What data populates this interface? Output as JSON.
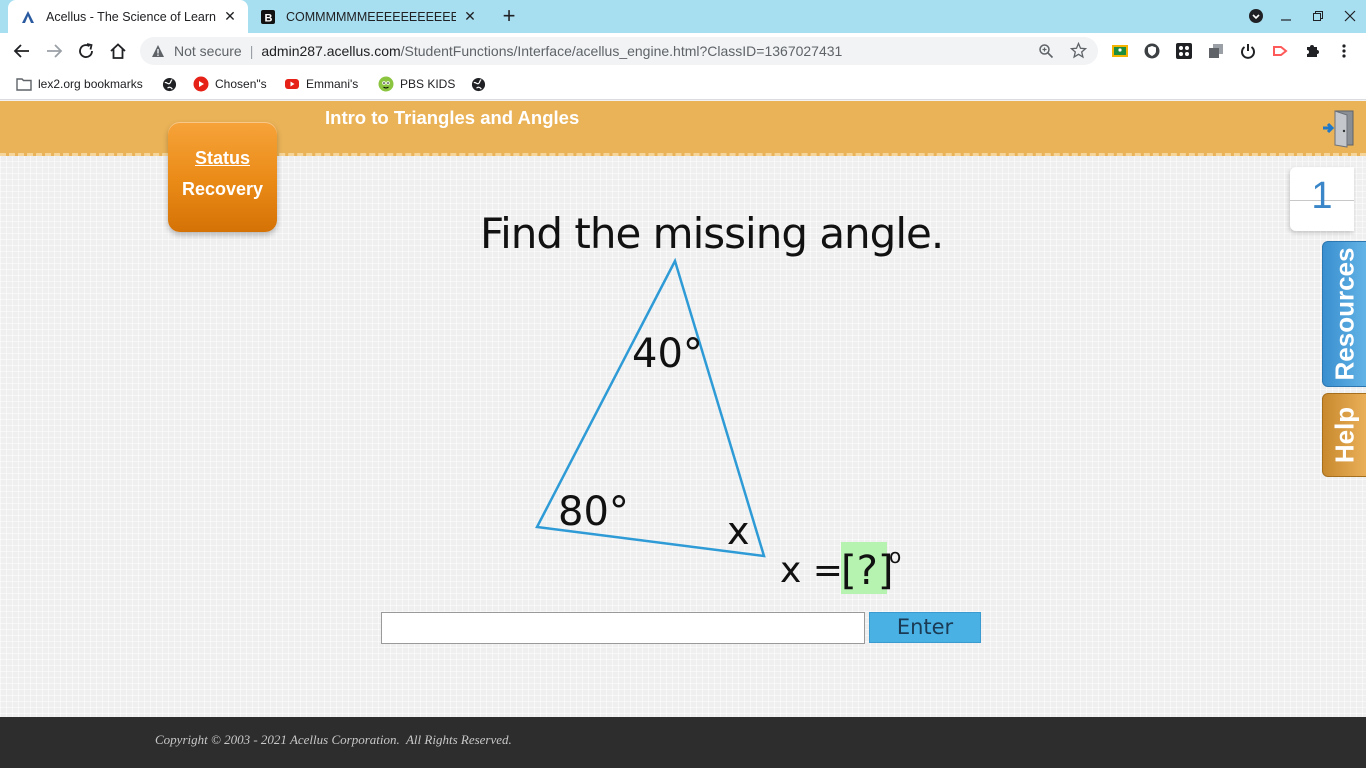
{
  "browser": {
    "tabs": [
      {
        "title": "Acellus - The Science of Learning",
        "active": true
      },
      {
        "title": "COMMMMMMEEEEEEEEEEEEEEE",
        "active": false
      }
    ],
    "omnibox": {
      "security_label": "Not secure",
      "host": "admin287.acellus.com",
      "path": "/StudentFunctions/Interface/acellus_engine.html?ClassID=1367027431"
    },
    "bookmarks": [
      {
        "label": "lex2.org bookmarks",
        "icon": "folder-icon"
      },
      {
        "label": "",
        "icon": "globe-icon"
      },
      {
        "label": "Chosen\"s",
        "icon": "youtube-icon"
      },
      {
        "label": "Emmani's",
        "icon": "youtube-icon"
      },
      {
        "label": "PBS KIDS",
        "icon": "pbs-kids-icon"
      },
      {
        "label": "",
        "icon": "globe-icon"
      }
    ]
  },
  "lesson": {
    "title": "Intro to Triangles and Angles",
    "status_button": {
      "line1": "Status",
      "line2": "Recovery"
    },
    "counter": "1",
    "side_tabs": {
      "resources": "Resources",
      "help": "Help"
    }
  },
  "problem": {
    "question": "Find the missing angle.",
    "angle_top": "40°",
    "angle_left": "80°",
    "angle_right": "x",
    "equation_lhs": "x =",
    "equation_blank": "[?]",
    "equation_unit": "o"
  },
  "answer": {
    "value": "",
    "enter_label": "Enter"
  },
  "footer": {
    "copyright": "Copyright © 2003 - 2021 Acellus Corporation.  All Rights Reserved."
  },
  "colors": {
    "banner": "#eab358",
    "triangle": "#2e9bd6",
    "blank_highlight": "#b6f2b0",
    "enter_button": "#4ab1e5"
  }
}
